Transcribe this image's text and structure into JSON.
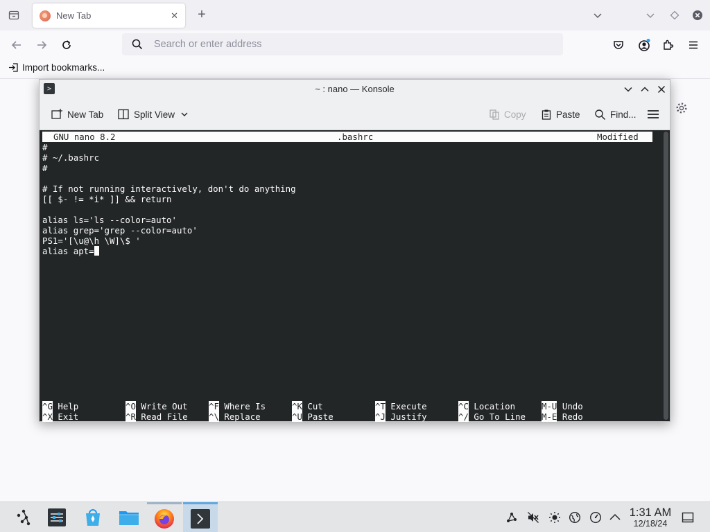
{
  "browser": {
    "tab": {
      "title": "New Tab",
      "close_glyph": "✕"
    },
    "newtab_glyph": "+",
    "address_placeholder": "Search or enter address",
    "bookmarks_item": "Import bookmarks...",
    "icons": [
      "tab-list-icon",
      "firefox-favicon",
      "tab-close-icon",
      "new-tab-icon",
      "list-all-tabs-icon",
      "chevron-down-icon",
      "view-icon",
      "close-browser-icon",
      "back-icon",
      "forward-icon",
      "reload-icon",
      "search-icon",
      "pocket-icon",
      "account-icon",
      "extensions-icon",
      "menu-icon",
      "import-icon",
      "settings-gear-icon"
    ]
  },
  "konsole": {
    "title": "~ : nano — Konsole",
    "toolbar": {
      "new_tab": "New Tab",
      "split_view": "Split View",
      "copy": "Copy",
      "paste": "Paste",
      "find": "Find..."
    }
  },
  "nano": {
    "version": "GNU nano 8.2",
    "filename": ".bashrc",
    "status": "Modified",
    "lines": [
      "#",
      "# ~/.bashrc",
      "#",
      "",
      "# If not running interactively, don't do anything",
      "[[ $- != *i* ]] && return",
      "",
      "alias ls='ls --color=auto'",
      "alias grep='grep --color=auto'",
      "PS1='[\\u@\\h \\W]\\$ '",
      "alias apt="
    ],
    "help_row1": [
      {
        "key": "^G",
        "label": "Help"
      },
      {
        "key": "^O",
        "label": "Write Out"
      },
      {
        "key": "^F",
        "label": "Where Is"
      },
      {
        "key": "^K",
        "label": "Cut"
      },
      {
        "key": "^T",
        "label": "Execute"
      },
      {
        "key": "^C",
        "label": "Location"
      },
      {
        "key": "M-U",
        "label": "Undo"
      }
    ],
    "help_row2": [
      {
        "key": "^X",
        "label": "Exit"
      },
      {
        "key": "^R",
        "label": "Read File"
      },
      {
        "key": "^\\",
        "label": "Replace"
      },
      {
        "key": "^U",
        "label": "Paste"
      },
      {
        "key": "^J",
        "label": "Justify"
      },
      {
        "key": "^/",
        "label": "Go To Line"
      },
      {
        "key": "M-E",
        "label": "Redo"
      }
    ]
  },
  "taskbar": {
    "apps": [
      "application-launcher-icon",
      "system-settings-icon",
      "discover-store-icon",
      "file-manager-icon",
      "firefox-icon",
      "konsole-icon"
    ],
    "tray": [
      "network-icon",
      "volume-muted-icon",
      "brightness-icon",
      "vpn-globe-icon",
      "clipboard-icon",
      "tray-expand-icon"
    ],
    "time": "1:31 AM",
    "date": "12/18/24"
  },
  "colors": {
    "terminal_bg": "#232627",
    "terminal_fg": "#fcfcfc",
    "accent": "#5fa8e0"
  }
}
